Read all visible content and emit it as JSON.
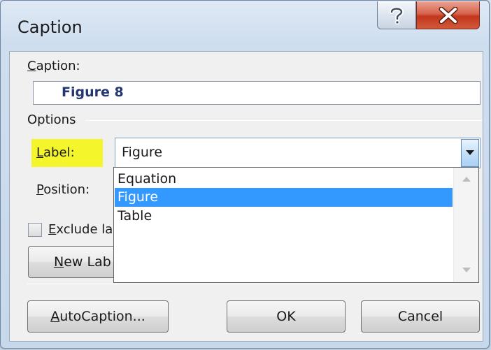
{
  "window": {
    "title": "Caption"
  },
  "caption_field": {
    "label": "aption:",
    "label_mnemonic": "C",
    "value": "Figure 8"
  },
  "options": {
    "heading": "Options",
    "label_field": {
      "label": "abel:",
      "label_mnemonic": "L",
      "value": "Figure"
    },
    "position_field": {
      "label": "osition:",
      "label_mnemonic": "P"
    },
    "exclude_checkbox": {
      "label": "xclude la",
      "label_mnemonic": "E",
      "checked": false
    },
    "new_label_button": {
      "label": "ew Lab",
      "label_mnemonic": "N"
    }
  },
  "dropdown": {
    "items": [
      "Equation",
      "Figure",
      "Table"
    ],
    "selected": "Figure"
  },
  "buttons": {
    "autocaption": {
      "label": "utoCaption...",
      "mnemonic": "A"
    },
    "ok": "OK",
    "cancel": "Cancel"
  },
  "icons": {
    "help": "help-question-icon",
    "close": "close-x-icon",
    "dropdown": "chevron-down-icon"
  },
  "colors": {
    "label_highlight": "#f5f52b",
    "selection": "#3399ff",
    "caption_text": "#23366f",
    "close_button": "#c3361c"
  }
}
